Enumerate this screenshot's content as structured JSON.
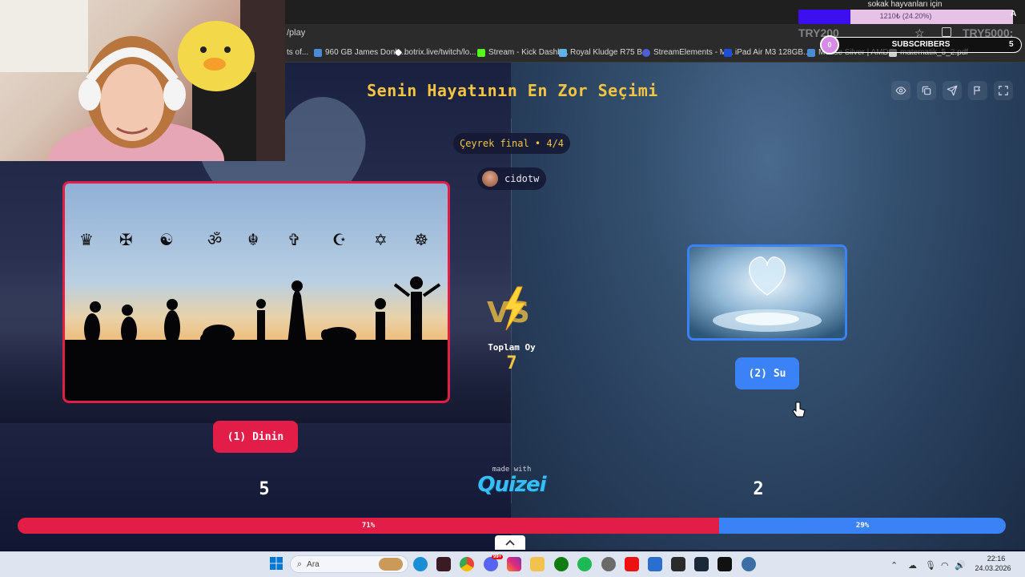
{
  "browser": {
    "url": "/play",
    "bookmarks": [
      "ts of...",
      "960 GB James Donk...",
      "botrix.live/twitch/lo...",
      "Stream - Kick Dashb...",
      "Royal Kludge R75 B...",
      "StreamElements - M...",
      "iPad Air M3 128GB...",
      "Mouse Silver | AMD...",
      "matematik_5_2.pdf"
    ]
  },
  "quiz": {
    "title": "Senin Hayatının En Zor Seçimi",
    "round": "Çeyrek final • 4/4",
    "user": "cidotw",
    "left_choice": {
      "label": "(1) Dinin",
      "votes": "5",
      "percent": "71%"
    },
    "right_choice": {
      "label": "(2) Su",
      "votes": "2",
      "percent": "29%"
    },
    "total_label": "Toplam Oy",
    "total_value": "7",
    "made_with": "made with",
    "brand": "Quizei",
    "vs": "VS"
  },
  "progress": {
    "left_fraction": 0.71
  },
  "stream_overlay": {
    "goal_title": "sokak hayvanları için",
    "goal_amount": "1210₺ (24.20%)",
    "goal_fraction": 0.242,
    "goal_tail": "A",
    "try_left": "TRY200",
    "try_right": "TRY5000:",
    "subs_label": "SUBSCRIBERS",
    "subs_current": "0",
    "subs_target": "5"
  },
  "taskbar": {
    "search_label": "Ara",
    "time": "22:16",
    "date": "24.03.2026",
    "chat_badge": "99+"
  },
  "colors": {
    "accent_left": "#e11d48",
    "accent_right": "#3b82f6",
    "title_yellow": "#f5c542"
  }
}
